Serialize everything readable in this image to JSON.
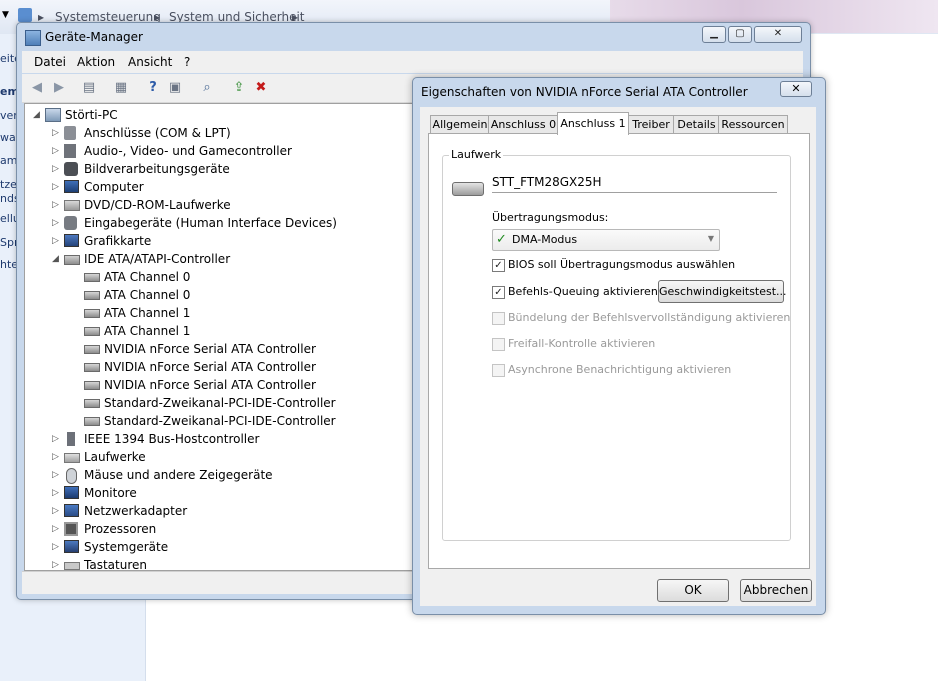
{
  "background": {
    "breadcrumb": [
      "Systemsteuerung",
      "System und Sicherheit"
    ],
    "sidebar_fragments": [
      "eite",
      "em",
      "ver",
      "war",
      "am",
      "tze",
      "nds",
      "ellu",
      "Spr",
      "hte"
    ]
  },
  "device_manager": {
    "title": "Geräte-Manager",
    "menu": [
      "Datei",
      "Aktion",
      "Ansicht",
      "?"
    ],
    "tree": {
      "root": "Störti-PC",
      "categories": [
        {
          "label": "Anschlüsse (COM & LPT)",
          "icon": "port-icon"
        },
        {
          "label": "Audio-, Video- und Gamecontroller",
          "icon": "speaker-icon"
        },
        {
          "label": "Bildverarbeitungsgeräte",
          "icon": "camera-icon"
        },
        {
          "label": "Computer",
          "icon": "computer-icon"
        },
        {
          "label": "DVD/CD-ROM-Laufwerke",
          "icon": "disc-drive-icon"
        },
        {
          "label": "Eingabegeräte (Human Interface Devices)",
          "icon": "hid-icon"
        },
        {
          "label": "Grafikkarte",
          "icon": "display-adapter-icon"
        },
        {
          "label": "IDE ATA/ATAPI-Controller",
          "icon": "ide-controller-icon",
          "expanded": true
        }
      ],
      "ide_children": [
        "ATA Channel 0",
        "ATA Channel 0",
        "ATA Channel 1",
        "ATA Channel 1",
        "NVIDIA nForce Serial ATA Controller",
        "NVIDIA nForce Serial ATA Controller",
        "NVIDIA nForce Serial ATA Controller",
        "Standard-Zweikanal-PCI-IDE-Controller",
        "Standard-Zweikanal-PCI-IDE-Controller"
      ],
      "categories_after": [
        {
          "label": "IEEE 1394 Bus-Hostcontroller",
          "icon": "firewire-icon"
        },
        {
          "label": "Laufwerke",
          "icon": "disk-drive-icon"
        },
        {
          "label": "Mäuse und andere Zeigegeräte",
          "icon": "mouse-icon"
        },
        {
          "label": "Monitore",
          "icon": "monitor-icon"
        },
        {
          "label": "Netzwerkadapter",
          "icon": "network-adapter-icon"
        },
        {
          "label": "Prozessoren",
          "icon": "processor-icon"
        },
        {
          "label": "Systemgeräte",
          "icon": "system-device-icon"
        },
        {
          "label": "Tastaturen",
          "icon": "keyboard-icon"
        }
      ]
    }
  },
  "properties_dialog": {
    "title": "Eigenschaften von NVIDIA nForce Serial ATA Controller",
    "close_glyph": "✕",
    "tabs": [
      "Allgemein",
      "Anschluss 0",
      "Anschluss 1",
      "Treiber",
      "Details",
      "Ressourcen"
    ],
    "active_tab": "Anschluss 1",
    "group_label": "Laufwerk",
    "drive_name": "STT_FTM28GX25H",
    "transfer_mode_label": "Übertragungsmodus:",
    "transfer_mode_value": "DMA-Modus",
    "options": [
      {
        "label": "BIOS soll Übertragungsmodus auswählen",
        "checked": true,
        "enabled": true
      },
      {
        "label": "Befehls-Queuing aktivieren",
        "checked": true,
        "enabled": true
      },
      {
        "label": "Bündelung der Befehlsvervollständigung aktivieren",
        "checked": false,
        "enabled": false
      },
      {
        "label": "Freifall-Kontrolle aktivieren",
        "checked": false,
        "enabled": false
      },
      {
        "label": "Asynchrone Benachrichtigung aktivieren",
        "checked": false,
        "enabled": false
      }
    ],
    "speed_test_button": "Geschwindigkeitstest...",
    "ok_button": "OK",
    "cancel_button": "Abbrechen"
  }
}
